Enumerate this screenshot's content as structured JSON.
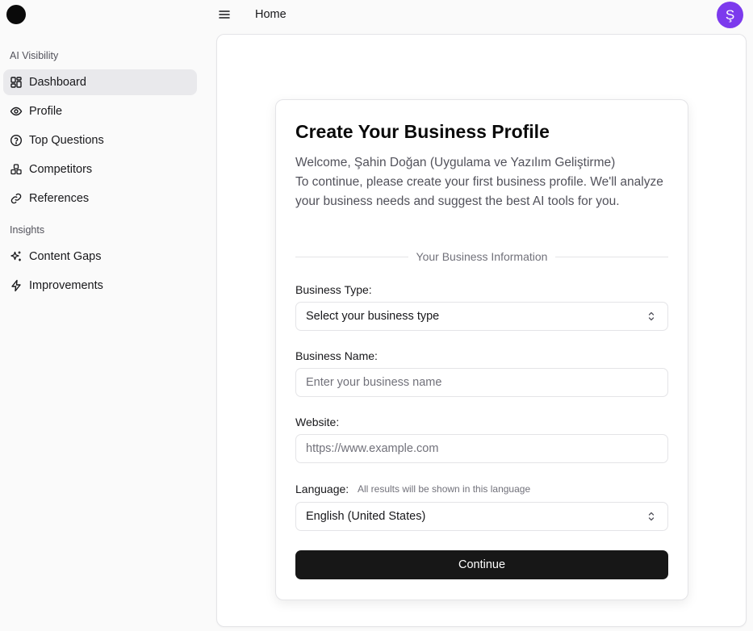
{
  "header": {
    "breadcrumb": "Home",
    "avatar_initial": "Ş"
  },
  "sidebar": {
    "groups": [
      {
        "label": "AI Visibility",
        "items": [
          "Dashboard",
          "Profile",
          "Top Questions",
          "Competitors",
          "References"
        ]
      },
      {
        "label": "Insights",
        "items": [
          "Content Gaps",
          "Improvements"
        ]
      }
    ],
    "active_item": "Dashboard"
  },
  "form": {
    "title": "Create Your Business Profile",
    "welcome_line": "Welcome, Şahin Doğan (Uygulama ve Yazılım Geliştirme)",
    "intro": "To continue, please create your first business profile. We'll analyze your business needs and suggest the best AI tools for you.",
    "section_label": "Your Business Information",
    "business_type": {
      "label": "Business Type:",
      "value": "Select your business type"
    },
    "business_name": {
      "label": "Business Name:",
      "placeholder": "Enter your business name"
    },
    "website": {
      "label": "Website:",
      "placeholder": "https://www.example.com"
    },
    "language": {
      "label": "Language:",
      "hint": "All results will be shown in this language",
      "value": "English (United States)"
    },
    "continue_label": "Continue"
  },
  "colors": {
    "avatar": "#7c3aed",
    "primary_button": "#171717",
    "active_nav": "#e9e9ec"
  }
}
